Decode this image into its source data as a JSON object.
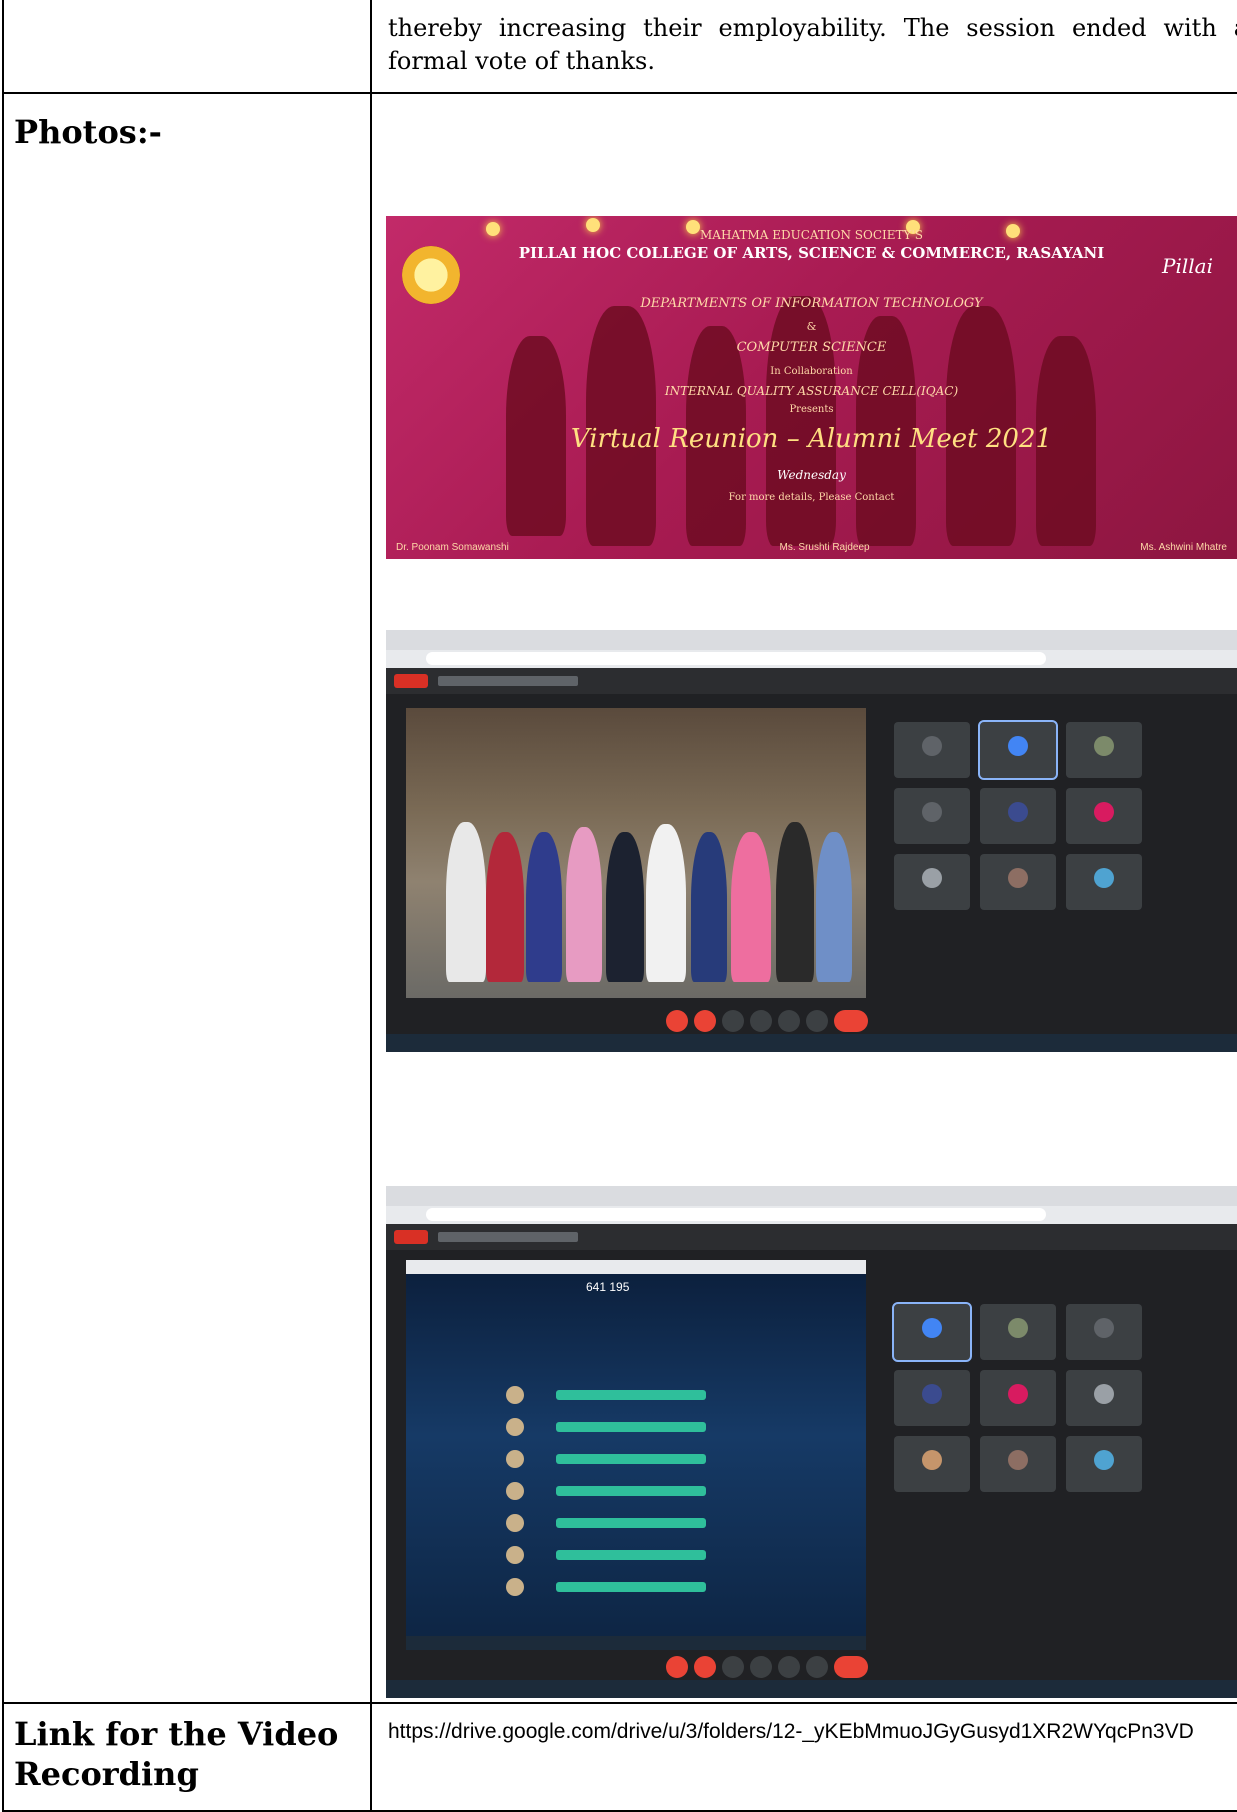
{
  "intro_text": "thereby increasing their employability. The session ended with a formal vote of thanks.",
  "photos_heading": "Photos:-",
  "link_heading": "Link for the Video Recording",
  "video_link": "https://drive.google.com/drive/u/3/folders/12-_yKEbMmuoJGyGusyd1XR2WYqcPn3VD",
  "poster": {
    "society": "MAHATMA EDUCATION SOCIETY'S",
    "college": "PILLAI HOC COLLEGE OF ARTS, SCIENCE & COMMERCE, RASAYANI",
    "dept1": "DEPARTMENTS OF INFORMATION TECHNOLOGY",
    "and": "&",
    "dept2": "COMPUTER SCIENCE",
    "collab": "In Collaboration",
    "iqac": "INTERNAL QUALITY ASSURANCE CELL(IQAC)",
    "presents": "Presents",
    "event": "Virtual Reunion – Alumni Meet 2021",
    "day": "Wednesday",
    "contact": "For more details, Please Contact",
    "footer": [
      "Dr. Poonam Somawanshi",
      "Ms. Srushti Rajdeep",
      "Ms. Ashwini Mhatre"
    ]
  },
  "screenshot2": {
    "score": "641 195"
  }
}
